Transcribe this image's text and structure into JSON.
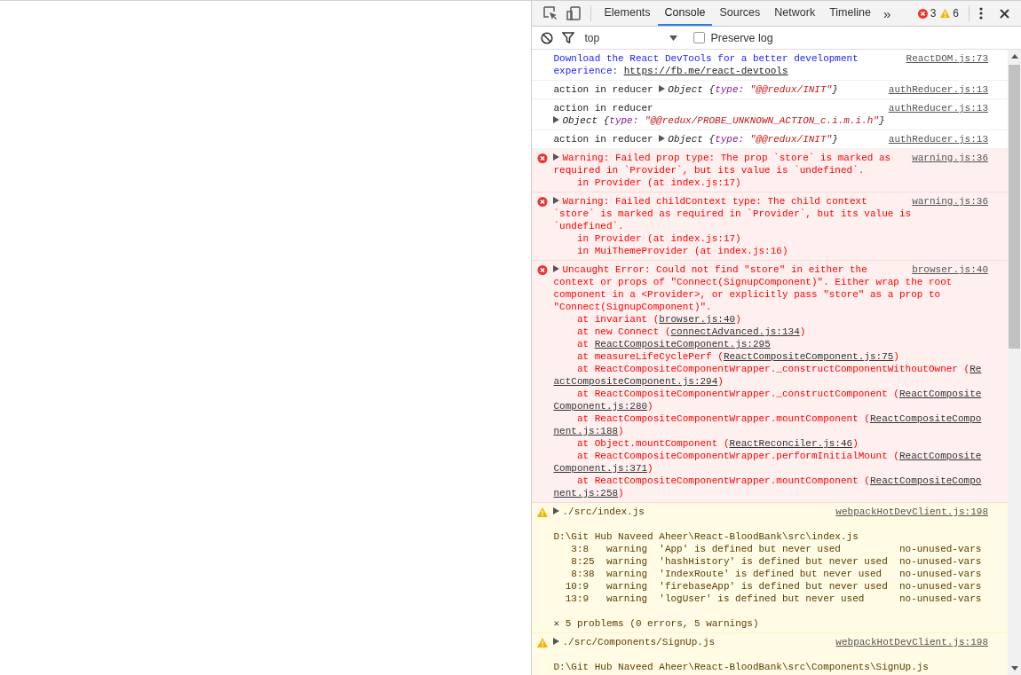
{
  "tabs": [
    {
      "label": "Elements",
      "selected": false
    },
    {
      "label": "Console",
      "selected": true
    },
    {
      "label": "Sources",
      "selected": false
    },
    {
      "label": "Network",
      "selected": false
    },
    {
      "label": "Timeline",
      "selected": false
    }
  ],
  "more_tabs": "»",
  "error_count": "3",
  "warning_count": "6",
  "console_toolbar": {
    "context": "top",
    "preserve_log": {
      "label": "Preserve log",
      "checked": false
    }
  },
  "messages": [
    {
      "kind": "info",
      "source": "ReactDOM.js:73",
      "lines": [
        {
          "kind": "text",
          "segments": [
            {
              "kind": "plain",
              "text": "Download the React DevTools for a better development"
            }
          ]
        },
        {
          "kind": "text",
          "segments": [
            {
              "kind": "plain",
              "text": "experience: "
            },
            {
              "kind": "link",
              "text": "https://fb.me/react-devtools"
            }
          ]
        }
      ]
    },
    {
      "kind": "log",
      "source": "authReducer.js:13",
      "lines": [
        {
          "kind": "text",
          "segments": [
            {
              "kind": "plain",
              "text": "action in reducer "
            },
            {
              "kind": "toggle"
            },
            {
              "kind": "obj",
              "text": "Object {"
            },
            {
              "kind": "key",
              "text": "type: "
            },
            {
              "kind": "str",
              "text": "\"@@redux/INIT\""
            },
            {
              "kind": "obj",
              "text": "}"
            }
          ]
        }
      ]
    },
    {
      "kind": "log",
      "source": "authReducer.js:13",
      "lines": [
        {
          "kind": "text",
          "segments": [
            {
              "kind": "plain",
              "text": "action in reducer"
            }
          ]
        },
        {
          "kind": "text",
          "segments": [
            {
              "kind": "toggle"
            },
            {
              "kind": "obj",
              "text": "Object {"
            },
            {
              "kind": "key",
              "text": "type: "
            },
            {
              "kind": "str",
              "text": "\"@@redux/PROBE_UNKNOWN_ACTION_c.i.m.i.h\""
            },
            {
              "kind": "obj",
              "text": "}"
            }
          ]
        }
      ]
    },
    {
      "kind": "log",
      "source": "authReducer.js:13",
      "lines": [
        {
          "kind": "text",
          "segments": [
            {
              "kind": "plain",
              "text": "action in reducer "
            },
            {
              "kind": "toggle"
            },
            {
              "kind": "obj",
              "text": "Object {"
            },
            {
              "kind": "key",
              "text": "type: "
            },
            {
              "kind": "str",
              "text": "\"@@redux/INIT\""
            },
            {
              "kind": "obj",
              "text": "}"
            }
          ]
        }
      ]
    },
    {
      "kind": "error",
      "source": "warning.js:36",
      "lines": [
        {
          "kind": "text",
          "segments": [
            {
              "kind": "toggle"
            },
            {
              "kind": "plain",
              "text": "Warning: Failed prop type: The prop `store` is marked as"
            }
          ]
        },
        {
          "kind": "text",
          "segments": [
            {
              "kind": "plain",
              "text": "required in `Provider`, but its value is `undefined`."
            }
          ]
        },
        {
          "kind": "text",
          "segments": [
            {
              "kind": "plain",
              "text": "    in Provider (at index.js:17)"
            }
          ]
        }
      ]
    },
    {
      "kind": "error",
      "source": "warning.js:36",
      "lines": [
        {
          "kind": "text",
          "segments": [
            {
              "kind": "toggle"
            },
            {
              "kind": "plain",
              "text": "Warning: Failed childContext type: The child context"
            }
          ]
        },
        {
          "kind": "text",
          "segments": [
            {
              "kind": "plain",
              "text": "`store` is marked as required in `Provider`, but its value is"
            }
          ]
        },
        {
          "kind": "text",
          "segments": [
            {
              "kind": "plain",
              "text": "`undefined`."
            }
          ]
        },
        {
          "kind": "text",
          "segments": [
            {
              "kind": "plain",
              "text": "    in Provider (at index.js:17)"
            }
          ]
        },
        {
          "kind": "text",
          "segments": [
            {
              "kind": "plain",
              "text": "    in MuiThemeProvider (at index.js:16)"
            }
          ]
        }
      ]
    },
    {
      "kind": "error",
      "source": "browser.js:40",
      "lines": [
        {
          "kind": "text",
          "segments": [
            {
              "kind": "toggle"
            },
            {
              "kind": "plain",
              "text": "Uncaught Error: Could not find \"store\" in either the"
            }
          ]
        },
        {
          "kind": "text",
          "segments": [
            {
              "kind": "plain",
              "text": "context or props of \"Connect(SignupComponent)\". Either wrap the root"
            }
          ]
        },
        {
          "kind": "text",
          "segments": [
            {
              "kind": "plain",
              "text": "component in a <Provider>, or explicitly pass \"store\" as a prop to"
            }
          ]
        },
        {
          "kind": "text",
          "segments": [
            {
              "kind": "plain",
              "text": "\"Connect(SignupComponent)\"."
            }
          ]
        },
        {
          "kind": "text",
          "segments": [
            {
              "kind": "plain",
              "text": "    at invariant ("
            },
            {
              "kind": "link",
              "text": "browser.js:40"
            },
            {
              "kind": "plain",
              "text": ")"
            }
          ]
        },
        {
          "kind": "text",
          "segments": [
            {
              "kind": "plain",
              "text": "    at new Connect ("
            },
            {
              "kind": "link",
              "text": "connectAdvanced.js:134"
            },
            {
              "kind": "plain",
              "text": ")"
            }
          ]
        },
        {
          "kind": "text",
          "segments": [
            {
              "kind": "plain",
              "text": "    at "
            },
            {
              "kind": "link",
              "text": "ReactCompositeComponent.js:295"
            }
          ]
        },
        {
          "kind": "text",
          "segments": [
            {
              "kind": "plain",
              "text": "    at measureLifeCyclePerf ("
            },
            {
              "kind": "link",
              "text": "ReactCompositeComponent.js:75"
            },
            {
              "kind": "plain",
              "text": ")"
            }
          ]
        },
        {
          "kind": "text",
          "segments": [
            {
              "kind": "plain",
              "text": "    at ReactCompositeComponentWrapper._constructComponentWithoutOwner ("
            },
            {
              "kind": "link",
              "text": "Re"
            }
          ]
        },
        {
          "kind": "text",
          "segments": [
            {
              "kind": "link",
              "text": "actCompositeComponent.js:294"
            },
            {
              "kind": "plain",
              "text": ")"
            }
          ]
        },
        {
          "kind": "text",
          "segments": [
            {
              "kind": "plain",
              "text": "    at ReactCompositeComponentWrapper._constructComponent ("
            },
            {
              "kind": "link",
              "text": "ReactComposite"
            }
          ]
        },
        {
          "kind": "text",
          "segments": [
            {
              "kind": "link",
              "text": "Component.js:280"
            },
            {
              "kind": "plain",
              "text": ")"
            }
          ]
        },
        {
          "kind": "text",
          "segments": [
            {
              "kind": "plain",
              "text": "    at ReactCompositeComponentWrapper.mountComponent ("
            },
            {
              "kind": "link",
              "text": "ReactCompositeCompo"
            }
          ]
        },
        {
          "kind": "text",
          "segments": [
            {
              "kind": "link",
              "text": "nent.js:188"
            },
            {
              "kind": "plain",
              "text": ")"
            }
          ]
        },
        {
          "kind": "text",
          "segments": [
            {
              "kind": "plain",
              "text": "    at Object.mountComponent ("
            },
            {
              "kind": "link",
              "text": "ReactReconciler.js:46"
            },
            {
              "kind": "plain",
              "text": ")"
            }
          ]
        },
        {
          "kind": "text",
          "segments": [
            {
              "kind": "plain",
              "text": "    at ReactCompositeComponentWrapper.performInitialMount ("
            },
            {
              "kind": "link",
              "text": "ReactComposite"
            }
          ]
        },
        {
          "kind": "text",
          "segments": [
            {
              "kind": "link",
              "text": "Component.js:371"
            },
            {
              "kind": "plain",
              "text": ")"
            }
          ]
        },
        {
          "kind": "text",
          "segments": [
            {
              "kind": "plain",
              "text": "    at ReactCompositeComponentWrapper.mountComponent ("
            },
            {
              "kind": "link",
              "text": "ReactCompositeCompo"
            }
          ]
        },
        {
          "kind": "text",
          "segments": [
            {
              "kind": "link",
              "text": "nent.js:258"
            },
            {
              "kind": "plain",
              "text": ")"
            }
          ]
        }
      ]
    },
    {
      "kind": "warning",
      "source": "webpackHotDevClient.js:198",
      "lines": [
        {
          "kind": "text",
          "segments": [
            {
              "kind": "toggle"
            },
            {
              "kind": "plain",
              "text": "./src/index.js"
            }
          ]
        },
        {
          "kind": "blank"
        },
        {
          "kind": "text",
          "segments": [
            {
              "kind": "plain",
              "text": "D:\\Git Hub Naveed Aheer\\React-BloodBank\\src\\index.js"
            }
          ]
        },
        {
          "kind": "text",
          "segments": [
            {
              "kind": "plain",
              "text": "   3:8   warning  'App' is defined but never used          no-unused-vars"
            }
          ]
        },
        {
          "kind": "text",
          "segments": [
            {
              "kind": "plain",
              "text": "   8:25  warning  'hashHistory' is defined but never used  no-unused-vars"
            }
          ]
        },
        {
          "kind": "text",
          "segments": [
            {
              "kind": "plain",
              "text": "   8:38  warning  'IndexRoute' is defined but never used   no-unused-vars"
            }
          ]
        },
        {
          "kind": "text",
          "segments": [
            {
              "kind": "plain",
              "text": "  10:9   warning  'firebaseApp' is defined but never used  no-unused-vars"
            }
          ]
        },
        {
          "kind": "text",
          "segments": [
            {
              "kind": "plain",
              "text": "  13:9   warning  'logUser' is defined but never used      no-unused-vars"
            }
          ]
        },
        {
          "kind": "blank"
        },
        {
          "kind": "text",
          "segments": [
            {
              "kind": "plain",
              "text": "✕ 5 problems (0 errors, 5 warnings)"
            }
          ]
        }
      ]
    },
    {
      "kind": "warning",
      "source": "webpackHotDevClient.js:198",
      "lines": [
        {
          "kind": "text",
          "segments": [
            {
              "kind": "toggle"
            },
            {
              "kind": "plain",
              "text": "./src/Components/SignUp.js"
            }
          ]
        },
        {
          "kind": "blank"
        },
        {
          "kind": "text",
          "segments": [
            {
              "kind": "plain",
              "text": "D:\\Git Hub Naveed Aheer\\React-BloodBank\\src\\Components\\SignUp.js"
            }
          ]
        }
      ]
    }
  ]
}
